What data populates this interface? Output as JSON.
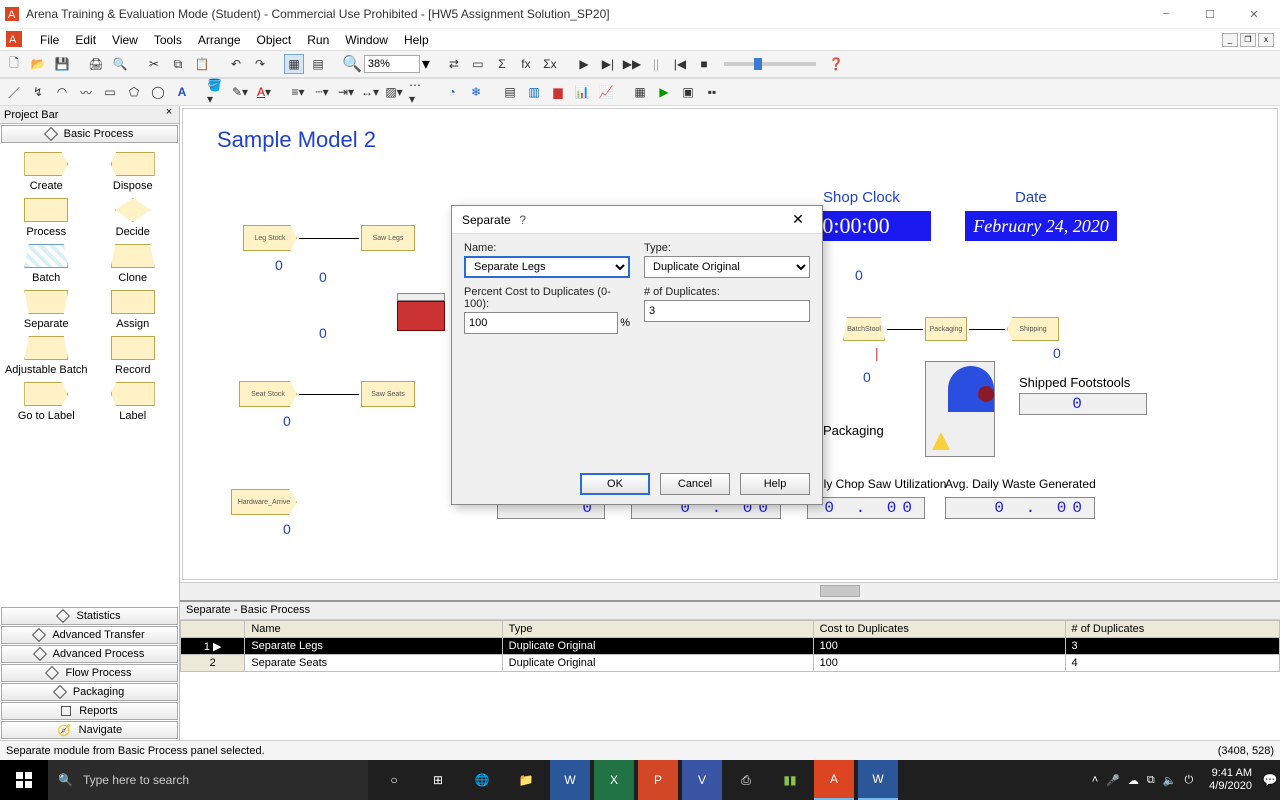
{
  "window": {
    "title": "Arena Training & Evaluation Mode (Student) - Commercial Use Prohibited - [HW5 Assignment Solution_SP20]"
  },
  "menu": {
    "items": [
      "File",
      "Edit",
      "View",
      "Tools",
      "Arrange",
      "Object",
      "Run",
      "Window",
      "Help"
    ]
  },
  "toolbar": {
    "zoom_value": "38%"
  },
  "projectbar": {
    "title": "Project Bar",
    "active_section": "Basic Process",
    "items": [
      "Create",
      "Dispose",
      "Process",
      "Decide",
      "Batch",
      "Clone",
      "Separate",
      "Assign",
      "Adjustable Batch",
      "Record",
      "Go to Label",
      "Label"
    ],
    "bottom_sections": [
      "Statistics",
      "Advanced Transfer",
      "Advanced Process",
      "Flow Process",
      "Packaging",
      "Reports",
      "Navigate"
    ]
  },
  "canvas": {
    "heading": "Sample Model 2",
    "shop_clock_label": "Shop Clock",
    "shop_clock_value": "0:00:00",
    "date_label": "Date",
    "date_value": "February 24, 2020",
    "blocks": {
      "leg_stock": "Leg Stock",
      "saw_legs": "Saw Legs",
      "seat_stock": "Seat Stock",
      "saw_seats": "Saw Seats",
      "hardware_arrive": "Hardware_Arrive",
      "batchstool": "BatchStool",
      "packaging": "Packaging",
      "shipping": "Shipping"
    },
    "packaging_label": "Packaging",
    "shipped_label": "Shipped Footstools",
    "shipped_value": "0",
    "util_label": "ily Chop Saw Utilization",
    "waste_label": "Avg. Daily Waste Generated",
    "metric_left": "0 . 00",
    "metric_mid": "0 . 00",
    "metric_right": "0 . 00",
    "metric_small": "0"
  },
  "dialog": {
    "title": "Separate",
    "name_label": "Name:",
    "type_label": "Type:",
    "name_value": "Separate Legs",
    "type_value": "Duplicate Original",
    "pct_label": "Percent Cost to Duplicates (0-100):",
    "pct_value": "100",
    "pct_suffix": "%",
    "dup_label": "# of Duplicates:",
    "dup_value": "3",
    "ok": "OK",
    "cancel": "Cancel",
    "help": "Help"
  },
  "grid": {
    "title": "Separate - Basic Process",
    "headers": [
      "Name",
      "Type",
      "Cost to Duplicates",
      "# of Duplicates"
    ],
    "rows": [
      {
        "n": "1",
        "name": "Separate Legs",
        "type": "Duplicate Original",
        "cost": "100",
        "dup": "3",
        "sel": true
      },
      {
        "n": "2",
        "name": "Separate Seats",
        "type": "Duplicate Original",
        "cost": "100",
        "dup": "4",
        "sel": false
      }
    ]
  },
  "status": {
    "left": "Separate module from Basic Process panel selected.",
    "right": "(3408, 528)"
  },
  "taskbar": {
    "search_placeholder": "Type here to search",
    "time": "9:41 AM",
    "date": "4/9/2020"
  }
}
